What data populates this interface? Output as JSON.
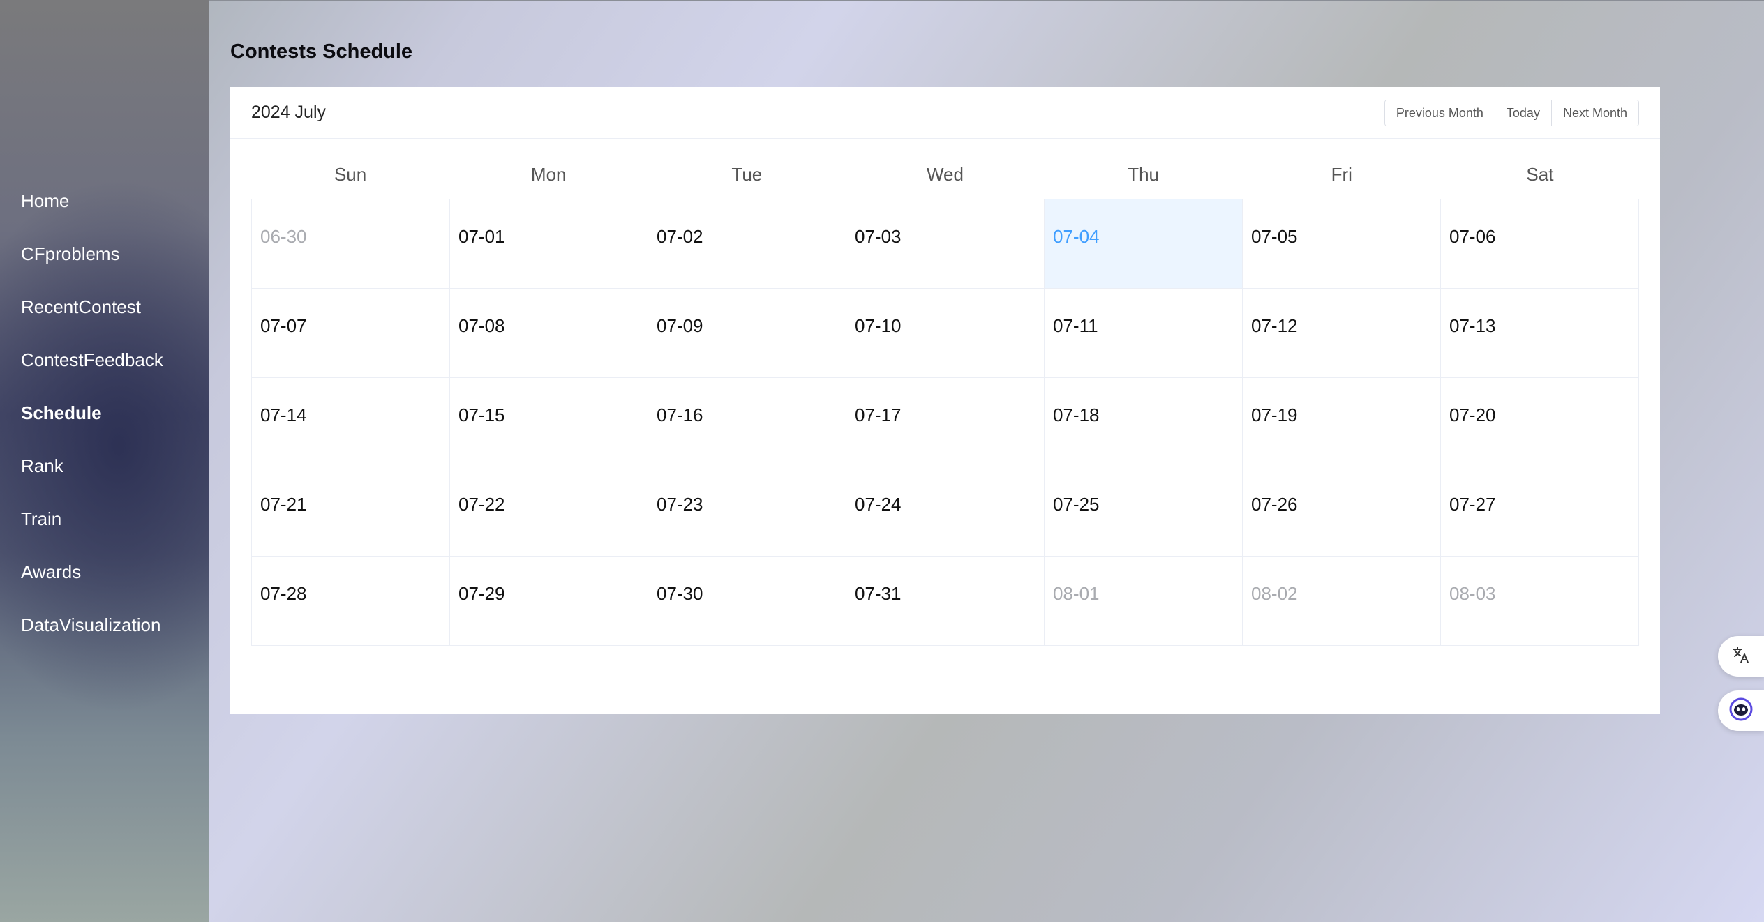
{
  "sidebar": {
    "items": [
      {
        "label": "Home",
        "active": false
      },
      {
        "label": "CFproblems",
        "active": false
      },
      {
        "label": "RecentContest",
        "active": false
      },
      {
        "label": "ContestFeedback",
        "active": false
      },
      {
        "label": "Schedule",
        "active": true
      },
      {
        "label": "Rank",
        "active": false
      },
      {
        "label": "Train",
        "active": false
      },
      {
        "label": "Awards",
        "active": false
      },
      {
        "label": "DataVisualization",
        "active": false
      }
    ]
  },
  "page": {
    "title": "Contests Schedule"
  },
  "calendar": {
    "month_label": "2024 July",
    "buttons": {
      "prev": "Previous Month",
      "today": "Today",
      "next": "Next Month"
    },
    "weekdays": [
      "Sun",
      "Mon",
      "Tue",
      "Wed",
      "Thu",
      "Fri",
      "Sat"
    ],
    "weeks": [
      [
        "06-30",
        "07-01",
        "07-02",
        "07-03",
        "07-04",
        "07-05",
        "07-06"
      ],
      [
        "07-07",
        "07-08",
        "07-09",
        "07-10",
        "07-11",
        "07-12",
        "07-13"
      ],
      [
        "07-14",
        "07-15",
        "07-16",
        "07-17",
        "07-18",
        "07-19",
        "07-20"
      ],
      [
        "07-21",
        "07-22",
        "07-23",
        "07-24",
        "07-25",
        "07-26",
        "07-27"
      ],
      [
        "07-28",
        "07-29",
        "07-30",
        "07-31",
        "08-01",
        "08-02",
        "08-03"
      ]
    ],
    "other_month_days": [
      "06-30",
      "08-01",
      "08-02",
      "08-03"
    ],
    "today": "07-04"
  },
  "floating_buttons": {
    "translate_icon": "translate-icon",
    "assistant_icon": "assistant-icon"
  },
  "colors": {
    "accent": "#409eff",
    "today_bg": "#ecf5ff",
    "other_month_text": "#a9abb0"
  }
}
